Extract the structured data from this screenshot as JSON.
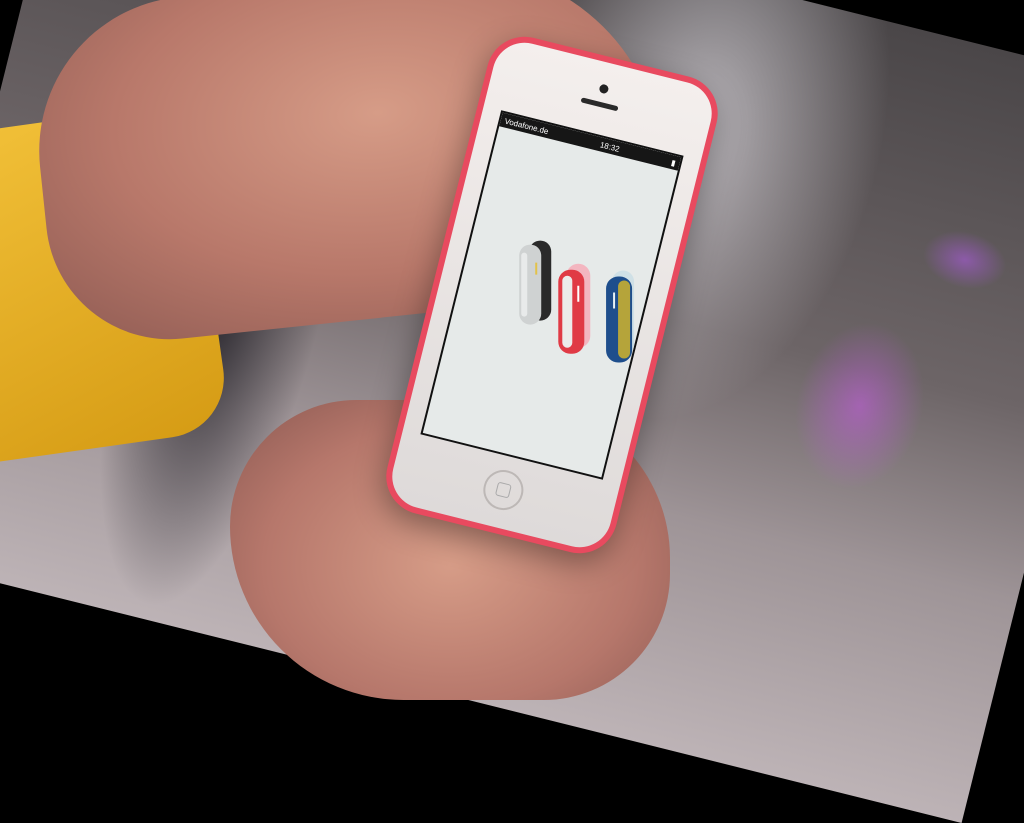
{
  "scene": {
    "description_colors": {
      "case": "#e84a5f",
      "sleeve": "#f3c23a",
      "background_glow": "#c85ae6"
    }
  },
  "phone": {
    "statusbar": {
      "carrier": "Vodafone.de",
      "time": "18:32"
    },
    "screen_content": {
      "speakers": [
        {
          "name": "speaker-white-black"
        },
        {
          "name": "speaker-red-white"
        },
        {
          "name": "speaker-blue-yellow"
        }
      ]
    }
  }
}
